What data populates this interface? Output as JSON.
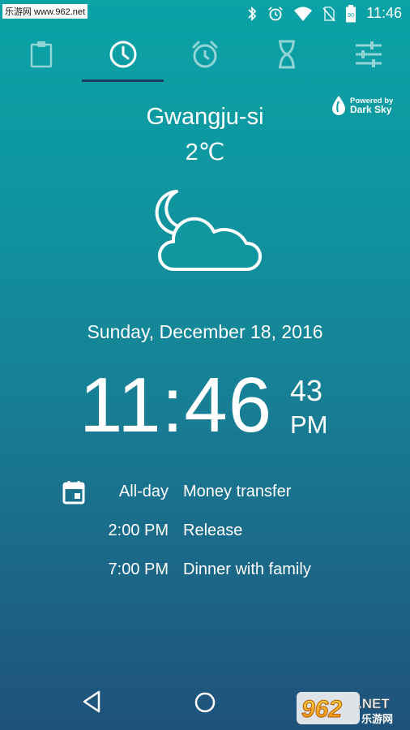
{
  "status_bar": {
    "watermark": "乐游网 www.962.net",
    "battery": "90",
    "time": "11:46"
  },
  "tabs": [
    {
      "id": "clipboard",
      "icon": "clipboard-icon",
      "active": false
    },
    {
      "id": "clock",
      "icon": "clock-icon",
      "active": true
    },
    {
      "id": "alarm",
      "icon": "alarm-icon",
      "active": false
    },
    {
      "id": "timer",
      "icon": "hourglass-icon",
      "active": false
    },
    {
      "id": "settings",
      "icon": "sliders-icon",
      "active": false
    }
  ],
  "weather": {
    "powered_by_line1": "Powered by",
    "powered_by_line2": "Dark Sky",
    "city": "Gwangju-si",
    "temperature": "2℃",
    "condition_icon": "night-cloudy-icon"
  },
  "clock": {
    "date": "Sunday, December 18, 2016",
    "time": "11:46",
    "seconds": "43",
    "ampm": "PM"
  },
  "events": [
    {
      "time": "All-day",
      "title": "Money transfer"
    },
    {
      "time": "2:00 PM",
      "title": "Release"
    },
    {
      "time": "7:00 PM",
      "title": "Dinner with family"
    }
  ],
  "footer": {
    "brand_number": "962",
    "brand_suffix": ".NET",
    "brand_cn": "乐游网"
  },
  "colors": {
    "accent_underline": "#1b3b63",
    "gradient_top": "#0aa3a6",
    "gradient_bottom": "#1f527b"
  }
}
